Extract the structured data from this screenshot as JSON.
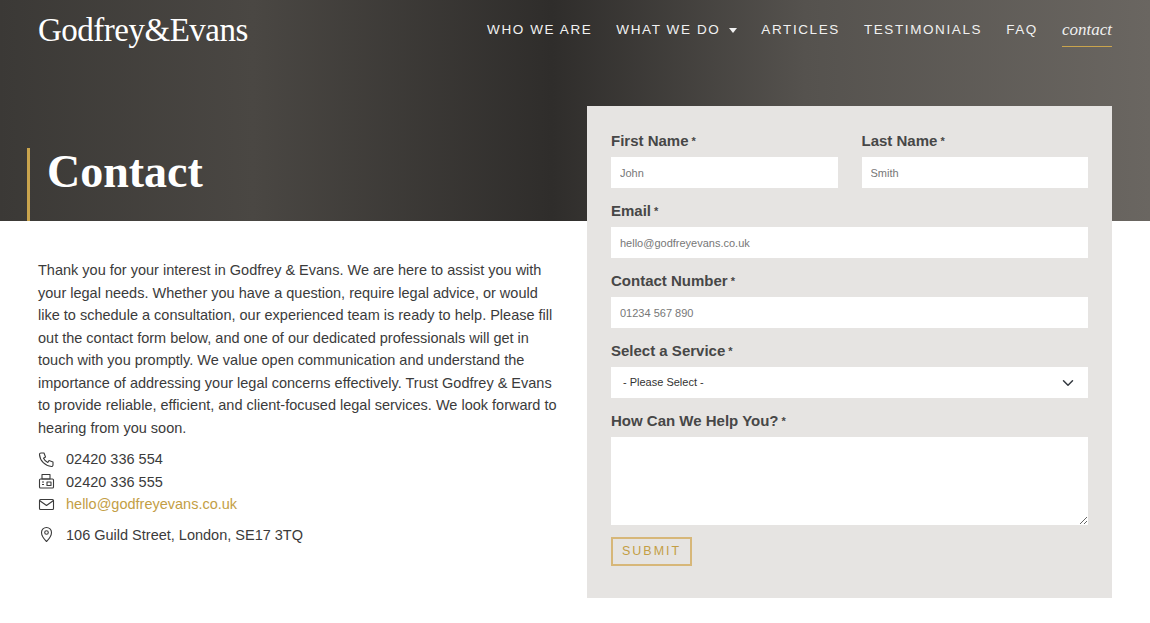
{
  "brand": {
    "logo": "Godfrey&Evans"
  },
  "nav": [
    {
      "label": "WHO WE ARE",
      "selected": false,
      "has_menu": false
    },
    {
      "label": "WHAT WE DO",
      "selected": false,
      "has_menu": true
    },
    {
      "label": "ARTICLES",
      "selected": false,
      "has_menu": false
    },
    {
      "label": "TESTIMONIALS",
      "selected": false,
      "has_menu": false
    },
    {
      "label": "FAQ",
      "selected": false,
      "has_menu": false
    },
    {
      "label": "contact",
      "selected": true,
      "has_menu": false
    }
  ],
  "hero": {
    "title": "Contact"
  },
  "intro": "Thank you for your interest in Godfrey & Evans. We are here to assist you with your legal needs. Whether you have a question, require legal advice, or would like to schedule a consultation, our experienced team is ready to help. Please fill out the contact form below, and one of our dedicated professionals will get in touch with you promptly. We value open communication and understand the importance of addressing your legal concerns effectively. Trust Godfrey & Evans to provide reliable, efficient, and client-focused legal services. We look forward to hearing from you soon.",
  "contacts": [
    {
      "kind": "phone",
      "text": "02420 336 554"
    },
    {
      "kind": "fax",
      "text": "02420 336 555"
    },
    {
      "kind": "email",
      "text": "hello@godfreyevans.co.uk"
    },
    {
      "kind": "address",
      "text": "106 Guild Street, London, SE17 3TQ"
    }
  ],
  "form": {
    "fields": [
      {
        "kind": "input",
        "label": "First Name",
        "required": "*",
        "placeholder": "John"
      },
      {
        "kind": "input",
        "label": "Last Name",
        "required": "*",
        "placeholder": "Smith"
      },
      {
        "kind": "input",
        "label": "Email",
        "required": "*",
        "placeholder": "hello@godfreyevans.co.uk"
      },
      {
        "kind": "input",
        "label": "Contact Number",
        "required": "*",
        "placeholder": "01234 567 890"
      },
      {
        "kind": "select",
        "label": "Select a Service",
        "required": "*",
        "value": "- Please Select -"
      },
      {
        "kind": "textarea",
        "label": "How Can We Help You?",
        "required": "*"
      }
    ],
    "submit": "SUBMIT"
  }
}
